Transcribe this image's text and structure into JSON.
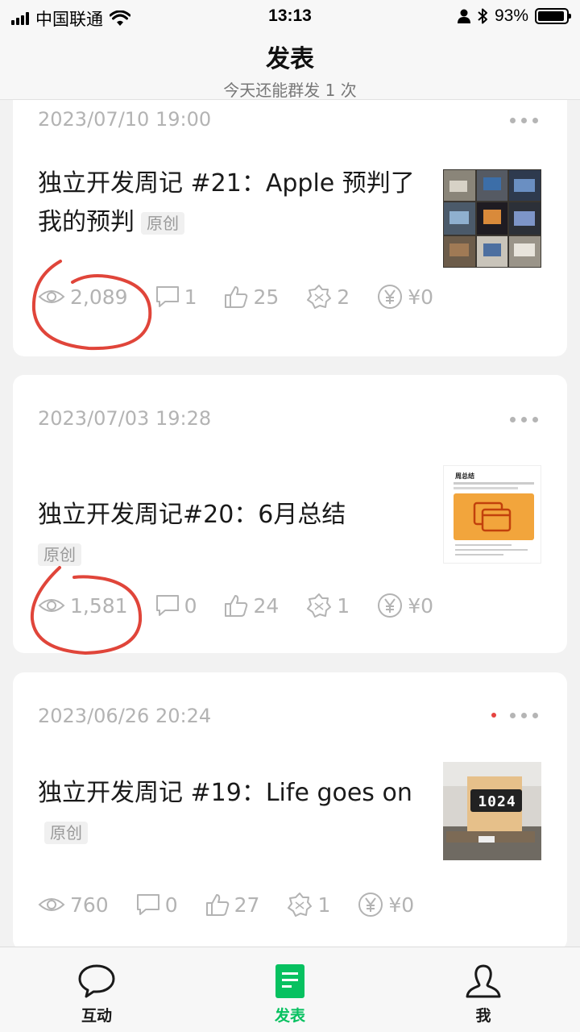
{
  "status_bar": {
    "carrier": "中国联通",
    "time": "13:13",
    "battery": "93%",
    "battery_level": 0.93
  },
  "header": {
    "title": "发表",
    "subtitle": "今天还能群发 1 次"
  },
  "posts": [
    {
      "date": "2023/07/10 19:00",
      "title": "独立开发周记 #21：Apple 预判了我的预判",
      "tag": "原创",
      "views": "2,089",
      "comments": "1",
      "likes": "25",
      "shares": "2",
      "reward": "¥0",
      "has_red_dot": false
    },
    {
      "date": "2023/07/03 19:28",
      "title": "独立开发周记#20：6月总结",
      "tag": "原创",
      "views": "1,581",
      "comments": "0",
      "likes": "24",
      "shares": "1",
      "reward": "¥0",
      "has_red_dot": false,
      "thumb_title": "周总结"
    },
    {
      "date": "2023/06/26 20:24",
      "title": "独立开发周记 #19：Life goes on",
      "tag": "原创",
      "views": "760",
      "comments": "0",
      "likes": "27",
      "shares": "1",
      "reward": "¥0",
      "has_red_dot": true,
      "thumb_clock": "1024"
    }
  ],
  "tabbar": {
    "items": [
      {
        "label": "互动",
        "icon": "chat-bubble-icon",
        "active": false
      },
      {
        "label": "发表",
        "icon": "document-icon",
        "active": true
      },
      {
        "label": "我",
        "icon": "person-icon",
        "active": false
      }
    ]
  },
  "colors": {
    "accent": "#07c160",
    "annotation_red": "#e0453a",
    "muted_text": "#b3b3b3"
  }
}
